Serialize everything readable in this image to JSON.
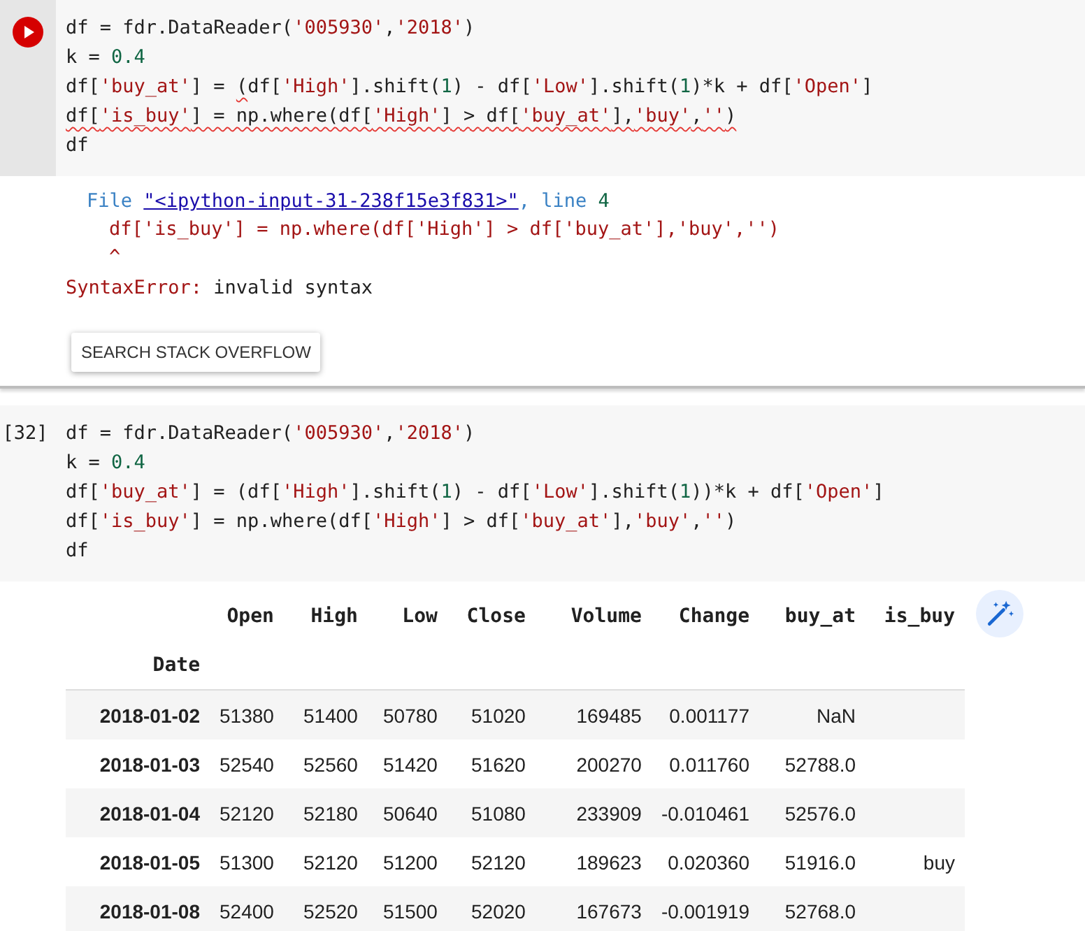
{
  "cells": [
    {
      "focused": true,
      "code": [
        [
          {
            "text": "df = fdr.DataReader(",
            "kind": "plain"
          },
          {
            "text": "'005930'",
            "kind": "string"
          },
          {
            "text": ",",
            "kind": "plain"
          },
          {
            "text": "'2018'",
            "kind": "string"
          },
          {
            "text": ")",
            "kind": "plain"
          }
        ],
        [
          {
            "text": "k = ",
            "kind": "plain"
          },
          {
            "text": "0.4",
            "kind": "number"
          }
        ],
        [
          {
            "text": "df[",
            "kind": "plain"
          },
          {
            "text": "'buy_at'",
            "kind": "string"
          },
          {
            "text": "] = ",
            "kind": "plain"
          },
          {
            "text": "(",
            "kind": "plain",
            "error": true
          },
          {
            "text": "df[",
            "kind": "plain"
          },
          {
            "text": "'High'",
            "kind": "string"
          },
          {
            "text": "].shift(",
            "kind": "plain"
          },
          {
            "text": "1",
            "kind": "number"
          },
          {
            "text": ") - df[",
            "kind": "plain"
          },
          {
            "text": "'Low'",
            "kind": "string"
          },
          {
            "text": "].shift(",
            "kind": "plain"
          },
          {
            "text": "1",
            "kind": "number"
          },
          {
            "text": ")*k + df[",
            "kind": "plain"
          },
          {
            "text": "'Open'",
            "kind": "string"
          },
          {
            "text": "]",
            "kind": "plain"
          }
        ],
        [
          {
            "text": "df[",
            "kind": "plain",
            "error": true
          },
          {
            "text": "'is_buy'",
            "kind": "string",
            "error": true
          },
          {
            "text": "] = np.where(df[",
            "kind": "plain",
            "error": true
          },
          {
            "text": "'High'",
            "kind": "string",
            "error": true
          },
          {
            "text": "] > df[",
            "kind": "plain",
            "error": true
          },
          {
            "text": "'buy_at'",
            "kind": "string",
            "error": true
          },
          {
            "text": "],",
            "kind": "plain",
            "error": true
          },
          {
            "text": "'buy'",
            "kind": "string",
            "error": true
          },
          {
            "text": ",",
            "kind": "plain",
            "error": true
          },
          {
            "text": "''",
            "kind": "string",
            "error": true
          },
          {
            "text": ")",
            "kind": "plain",
            "error": true
          }
        ],
        [
          {
            "text": "df",
            "kind": "plain"
          }
        ]
      ],
      "output": {
        "kind": "error",
        "traceback": [
          [
            {
              "text": "File ",
              "kind": "label"
            },
            {
              "text": "\"<ipython-input-31-238f15e3f831>\"",
              "kind": "link"
            },
            {
              "text": ", line ",
              "kind": "label"
            },
            {
              "text": "4",
              "kind": "number"
            }
          ],
          [
            {
              "text": "df['is_buy'] = np.where(df['High'] > df['buy_at'],'buy','')",
              "kind": "code"
            }
          ],
          [
            {
              "text": "^",
              "kind": "code"
            }
          ]
        ],
        "error_name": "SyntaxError:",
        "error_message": " invalid syntax",
        "button": "SEARCH STACK OVERFLOW"
      }
    },
    {
      "focused": false,
      "prompt": "[32]",
      "code": [
        [
          {
            "text": "df = fdr.DataReader(",
            "kind": "plain"
          },
          {
            "text": "'005930'",
            "kind": "string"
          },
          {
            "text": ",",
            "kind": "plain"
          },
          {
            "text": "'2018'",
            "kind": "string"
          },
          {
            "text": ")",
            "kind": "plain"
          }
        ],
        [
          {
            "text": "k = ",
            "kind": "plain"
          },
          {
            "text": "0.4",
            "kind": "number"
          }
        ],
        [
          {
            "text": "df[",
            "kind": "plain"
          },
          {
            "text": "'buy_at'",
            "kind": "string"
          },
          {
            "text": "] = (df[",
            "kind": "plain"
          },
          {
            "text": "'High'",
            "kind": "string"
          },
          {
            "text": "].shift(",
            "kind": "plain"
          },
          {
            "text": "1",
            "kind": "number"
          },
          {
            "text": ") - df[",
            "kind": "plain"
          },
          {
            "text": "'Low'",
            "kind": "string"
          },
          {
            "text": "].shift(",
            "kind": "plain"
          },
          {
            "text": "1",
            "kind": "number"
          },
          {
            "text": "))*k + df[",
            "kind": "plain"
          },
          {
            "text": "'Open'",
            "kind": "string"
          },
          {
            "text": "]",
            "kind": "plain"
          }
        ],
        [
          {
            "text": "df[",
            "kind": "plain"
          },
          {
            "text": "'is_buy'",
            "kind": "string"
          },
          {
            "text": "] = np.where(df[",
            "kind": "plain"
          },
          {
            "text": "'High'",
            "kind": "string"
          },
          {
            "text": "] > df[",
            "kind": "plain"
          },
          {
            "text": "'buy_at'",
            "kind": "string"
          },
          {
            "text": "],",
            "kind": "plain"
          },
          {
            "text": "'buy'",
            "kind": "string"
          },
          {
            "text": ",",
            "kind": "plain"
          },
          {
            "text": "''",
            "kind": "string"
          },
          {
            "text": ")",
            "kind": "plain"
          }
        ],
        [
          {
            "text": "df",
            "kind": "plain"
          }
        ]
      ],
      "output": {
        "kind": "table",
        "columns": [
          "Open",
          "High",
          "Low",
          "Close",
          "Volume",
          "Change",
          "buy_at",
          "is_buy"
        ],
        "index_name": "Date",
        "rows": [
          {
            "index": "2018-01-02",
            "cells": [
              "51380",
              "51400",
              "50780",
              "51020",
              "169485",
              "0.001177",
              "NaN",
              ""
            ]
          },
          {
            "index": "2018-01-03",
            "cells": [
              "52540",
              "52560",
              "51420",
              "51620",
              "200270",
              "0.011760",
              "52788.0",
              ""
            ]
          },
          {
            "index": "2018-01-04",
            "cells": [
              "52120",
              "52180",
              "50640",
              "51080",
              "233909",
              "-0.010461",
              "52576.0",
              ""
            ]
          },
          {
            "index": "2018-01-05",
            "cells": [
              "51300",
              "52120",
              "51200",
              "52120",
              "189623",
              "0.020360",
              "51916.0",
              "buy"
            ]
          },
          {
            "index": "2018-01-08",
            "cells": [
              "52400",
              "52520",
              "51500",
              "52020",
              "167673",
              "-0.001919",
              "52768.0",
              ""
            ]
          }
        ]
      }
    }
  ]
}
